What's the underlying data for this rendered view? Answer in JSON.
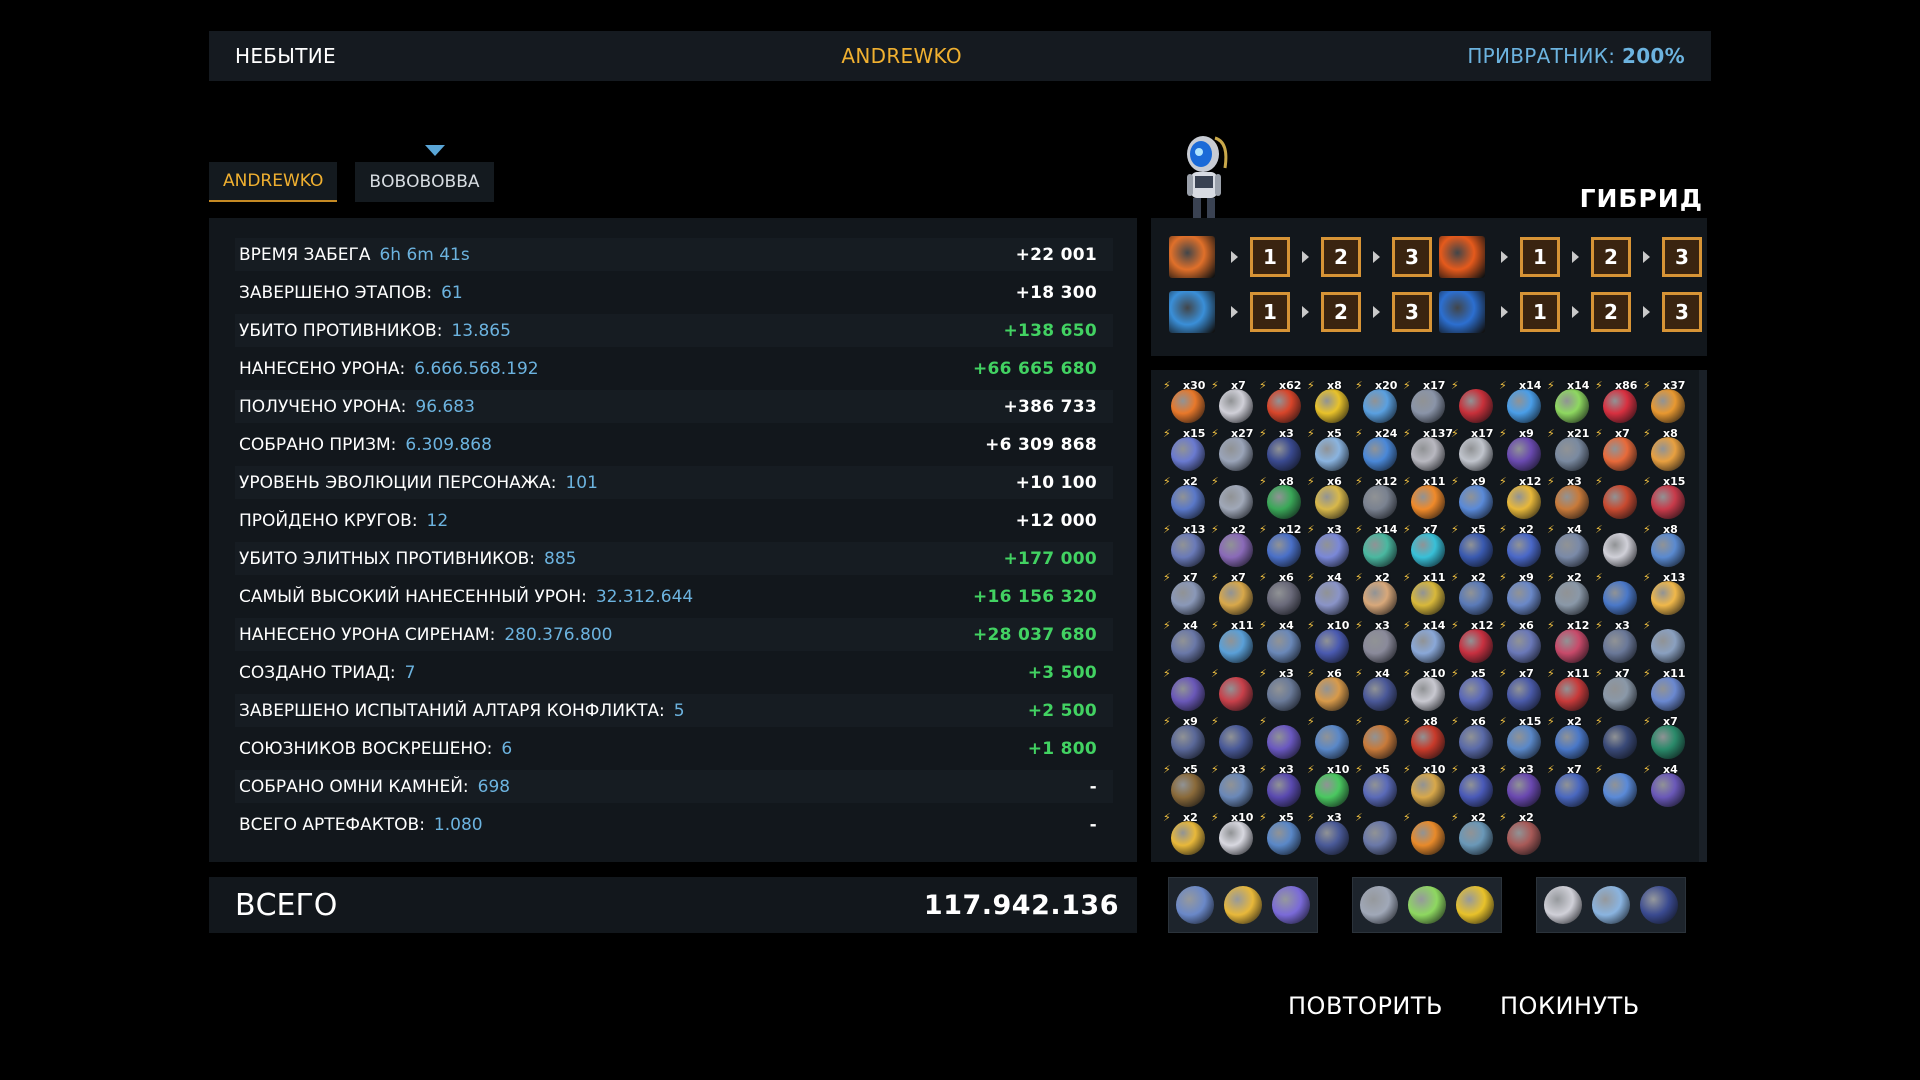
{
  "header": {
    "mode": "НЕБЫТИЕ",
    "player": "ANDREWKO",
    "gatekeeper_label": "ПРИВРАТНИК:",
    "gatekeeper_value": "200%"
  },
  "tabs": [
    {
      "label": "ANDREWKO"
    },
    {
      "label": "ВОВОВОВВА"
    }
  ],
  "stats": [
    {
      "label": "ВРЕМЯ ЗАБЕГА",
      "value": "6h 6m 41s",
      "score": "+22 001"
    },
    {
      "label": "ЗАВЕРШЕНО ЭТАПОВ:",
      "value": "61",
      "score": "+18 300"
    },
    {
      "label": "УБИТО ПРОТИВНИКОВ:",
      "value": "13.865",
      "score": "+138 650"
    },
    {
      "label": "НАНЕСЕНО УРОНА:",
      "value": "6.666.568.192",
      "score": "+66 665 680"
    },
    {
      "label": "ПОЛУЧЕНО УРОНА:",
      "value": "96.683",
      "score": "+386 733"
    },
    {
      "label": "СОБРАНО ПРИЗМ:",
      "value": "6.309.868",
      "score": "+6 309 868"
    },
    {
      "label": "УРОВЕНЬ ЭВОЛЮЦИИ ПЕРСОНАЖА:",
      "value": "101",
      "score": "+10 100"
    },
    {
      "label": "ПРОЙДЕНО КРУГОВ:",
      "value": "12",
      "score": "+12 000"
    },
    {
      "label": "УБИТО ЭЛИТНЫХ ПРОТИВНИКОВ:",
      "value": "885",
      "score": "+177 000"
    },
    {
      "label": "САМЫЙ ВЫСОКИЙ НАНЕСЕННЫЙ УРОН:",
      "value": "32.312.644",
      "score": "+16 156 320"
    },
    {
      "label": "НАНЕСЕНО УРОНА СИРЕНАМ:",
      "value": "280.376.800",
      "score": "+28 037 680"
    },
    {
      "label": "СОЗДАНО ТРИАД:",
      "value": "7",
      "score": "+3 500"
    },
    {
      "label": "ЗАВЕРШЕНО ИСПЫТАНИЙ АЛТАРЯ КОНФЛИКТА:",
      "value": "5",
      "score": "+2 500"
    },
    {
      "label": "СОЮЗНИКОВ ВОСКРЕШЕНО:",
      "value": "6",
      "score": "+1 800"
    },
    {
      "label": "СОБРАНО ОМНИ КАМНЕЙ:",
      "value": "698",
      "score": "-"
    },
    {
      "label": "ВСЕГО АРТЕФАКТОВ:",
      "value": "1.080",
      "score": "-"
    }
  ],
  "total": {
    "label": "ВСЕГО",
    "value": "117.942.136"
  },
  "character": {
    "class_name": "ГИБРИД",
    "avatar_icon": "robot-hybrid-icon"
  },
  "weapons": [
    {
      "icon": "slash-fire-icon",
      "color": "#e0702a",
      "levels": [
        "1",
        "2",
        "3"
      ]
    },
    {
      "icon": "fire-orb-icon",
      "color": "#e55a1c",
      "levels": [
        "1",
        "2",
        "3"
      ]
    },
    {
      "icon": "ice-dash-icon",
      "color": "#3a8fd8",
      "levels": [
        "1",
        "2",
        "3"
      ]
    },
    {
      "icon": "ice-hook-icon",
      "color": "#2c6fd0",
      "levels": [
        "1",
        "2",
        "3"
      ]
    }
  ],
  "items": {
    "counts": [
      "x30",
      "x7",
      "x62",
      "x8",
      "x20",
      "x17",
      "",
      "x14",
      "x14",
      "x86",
      "x37",
      "x15",
      "x27",
      "x3",
      "x5",
      "x24",
      "x137",
      "x17",
      "x9",
      "x21",
      "x7",
      "x8",
      "x2",
      "",
      "x8",
      "x6",
      "x12",
      "x11",
      "x9",
      "x12",
      "x3",
      "",
      "x15",
      "x13",
      "x2",
      "x12",
      "x3",
      "x14",
      "x7",
      "x5",
      "x2",
      "x4",
      "",
      "x8",
      "x7",
      "x7",
      "x6",
      "x4",
      "x2",
      "x11",
      "x2",
      "x9",
      "x2",
      "",
      "x13",
      "x4",
      "x11",
      "x4",
      "x10",
      "x3",
      "x14",
      "x12",
      "x6",
      "x12",
      "x3",
      "",
      "",
      "",
      "x3",
      "x6",
      "x4",
      "x10",
      "x5",
      "x7",
      "x11",
      "x7",
      "x11",
      "x9",
      "",
      "",
      "",
      "",
      "x8",
      "x6",
      "x15",
      "x2",
      "",
      "x7",
      "x5",
      "x3",
      "x3",
      "x10",
      "x5",
      "x10",
      "x3",
      "x3",
      "x7",
      "",
      "x4",
      "x2",
      "x10",
      "x5",
      "x3",
      "",
      "",
      "x2",
      "x2"
    ],
    "palette": [
      "#e8782a",
      "#d0d0d8",
      "#d8452a",
      "#e8c22a",
      "#5aa0e0",
      "#8a94a8",
      "#c8303a",
      "#4a9ee8",
      "#8ed860",
      "#d83040",
      "#e89830",
      "#6a7ad0",
      "#9aa4b8",
      "#3a4a90",
      "#8ab4e0",
      "#4a88d8",
      "#b8b8c0",
      "#c0c4cc",
      "#6a4ab0",
      "#7a8aa0",
      "#e86a3a",
      "#e8a040",
      "#5a78c8",
      "#a0a8b8",
      "#3aa858",
      "#d8b84a",
      "#7a8290",
      "#f08a2a",
      "#5a8ad8",
      "#e8b83a",
      "#c87a3a",
      "#c84a30",
      "#c83a4a",
      "#6a7ab8",
      "#8a6ab8",
      "#4a70c8",
      "#7a88d8",
      "#4ab8a0",
      "#38c0d8",
      "#3a5ab0",
      "#4a68c8",
      "#7a8aa8",
      "#d0d0d8",
      "#5a8ad0",
      "#8a98b8",
      "#d8a84a",
      "#6a6a7a",
      "#8a94c8",
      "#d8a87a",
      "#d8b83a",
      "#5a7ab8",
      "#6a88c8",
      "#8a98a8",
      "#4a78c8",
      "#f0b84a",
      "#6a78a8",
      "#5aa0d8",
      "#6a88b8",
      "#4a5ab0",
      "#8a8a9a",
      "#8aa8d8",
      "#c83040",
      "#6a78b8",
      "#c84a6a",
      "#6a7898",
      "#8aa0c0",
      "#6a58b8",
      "#c8404a",
      "#6a7a98",
      "#d89a4a",
      "#4a5898",
      "#c8c8d0",
      "#5a68b8",
      "#4a5aa8",
      "#c83a3a",
      "#8a98a8",
      "#6a88d0",
      "#5a6898",
      "#4a5a98",
      "#6a58c0",
      "#5a88c8",
      "#c87a3a",
      "#c83a2a",
      "#5a6aa8",
      "#5a88c8",
      "#4a78c8",
      "#3a4a78",
      "#2a8a6a",
      "#8a6a3a",
      "#6a88b8",
      "#5a4ab0",
      "#4ac860",
      "#5a6ab8",
      "#d8a84a",
      "#4a5ab8",
      "#6a48b0",
      "#4a68c0",
      "#5a8ad8",
      "#6a58b8",
      "#e8b83a",
      "#d8d8e0",
      "#5a88c8",
      "#4a5a98",
      "#6a78a8",
      "#e88a2a",
      "#6a98b8",
      "#a85a58"
    ]
  },
  "triads": [
    {
      "icons": [
        "lantern-icon",
        "gold-coin-icon",
        "gauntlet-icon"
      ],
      "colors": [
        "#6a88c8",
        "#e8b83a",
        "#7a6ad8"
      ]
    },
    {
      "icons": [
        "wheel-icon",
        "leaf-crystal-icon",
        "cross-icon"
      ],
      "colors": [
        "#a0a8b8",
        "#8ed860",
        "#e8c22a"
      ]
    },
    {
      "icons": [
        "ghost-mask-icon",
        "scroll-tablet-icon",
        "crown-ring-icon"
      ],
      "colors": [
        "#d0d0d8",
        "#8ab4e0",
        "#3a4a90"
      ]
    }
  ],
  "buttons": {
    "retry": "ПОВТОРИТЬ",
    "leave": "ПОКИНУТЬ"
  }
}
